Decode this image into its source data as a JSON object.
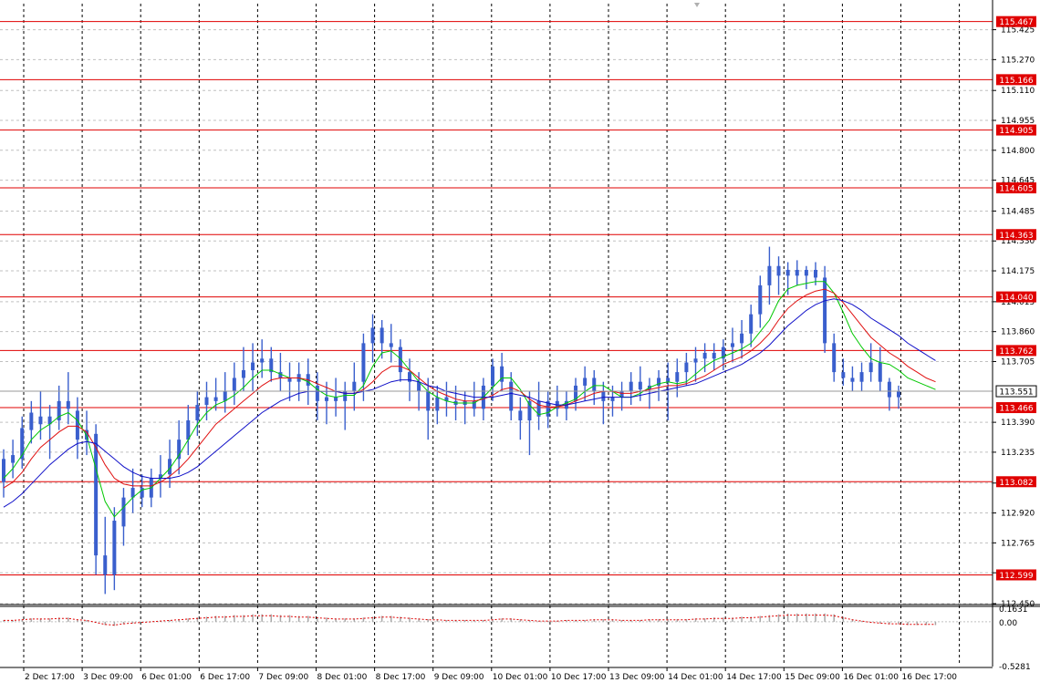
{
  "chart_data": {
    "type": "line",
    "symbol_scale": "price",
    "price_axis": {
      "ylim": [
        112.45,
        115.56
      ],
      "tick_labels": [
        "115.425",
        "115.270",
        "115.110",
        "114.955",
        "114.800",
        "114.645",
        "114.485",
        "114.330",
        "114.175",
        "114.015",
        "113.860",
        "113.705",
        "113.390",
        "113.235",
        "113.075",
        "112.920",
        "112.765",
        "112.610",
        "112.450"
      ],
      "current_price": "113.551"
    },
    "levels": [
      "115.467",
      "115.166",
      "114.905",
      "114.605",
      "114.363",
      "114.040",
      "113.762",
      "113.466",
      "113.082",
      "112.599"
    ],
    "time_axis": {
      "labels": [
        "2 Dec 17:00",
        "3 Dec 09:00",
        "6 Dec 01:00",
        "6 Dec 17:00",
        "7 Dec 09:00",
        "8 Dec 01:00",
        "8 Dec 17:00",
        "9 Dec 09:00",
        "10 Dec 01:00",
        "10 Dec 17:00",
        "13 Dec 09:00",
        "14 Dec 01:00",
        "14 Dec 17:00",
        "15 Dec 09:00",
        "16 Dec 01:00",
        "16 Dec 17:00"
      ]
    },
    "indicator": {
      "tick_labels": [
        "0.1631",
        "0.00",
        "-0.5281"
      ],
      "ylim": [
        -0.5281,
        0.1631
      ]
    },
    "series": [
      {
        "color": "#3a5fcd",
        "values": [
          113.15,
          113.2,
          113.28,
          113.35,
          113.42,
          113.4,
          113.45,
          113.5,
          113.38,
          113.3,
          113.25,
          112.75,
          112.62,
          112.85,
          113.0,
          113.05,
          113.0,
          113.08,
          113.12,
          113.18,
          113.25,
          113.35,
          113.45,
          113.52,
          113.5,
          113.55,
          113.6,
          113.62,
          113.7,
          113.72,
          113.68,
          113.65,
          113.6,
          113.65,
          113.62,
          113.55,
          113.52,
          113.5,
          113.55,
          113.52,
          113.6,
          113.75,
          113.85,
          113.82,
          113.7,
          113.65,
          113.6,
          113.55,
          113.5,
          113.52,
          113.48,
          113.5,
          113.45,
          113.55,
          113.6,
          113.7,
          113.62,
          113.5,
          113.42,
          113.38,
          113.45,
          113.5,
          113.48,
          113.52,
          113.58,
          113.62,
          113.6,
          113.55,
          113.48,
          113.5,
          113.55,
          113.58,
          113.62,
          113.6,
          113.58,
          113.6,
          113.65,
          113.7,
          113.72,
          113.75,
          113.72,
          113.78,
          113.82,
          113.9,
          113.95,
          114.1,
          114.15,
          114.1,
          114.12,
          114.15,
          114.12,
          114.1,
          113.85,
          113.7,
          113.65,
          113.62,
          113.6,
          113.7,
          113.65,
          113.58,
          113.55,
          113.55
        ]
      },
      {
        "color": "#00c800",
        "values": [
          113.1,
          113.15,
          113.22,
          113.3,
          113.35,
          113.38,
          113.42,
          113.44,
          113.4,
          113.32,
          113.15,
          112.98,
          112.9,
          112.95,
          113.0,
          113.04,
          113.05,
          113.1,
          113.15,
          113.22,
          113.3,
          113.38,
          113.44,
          113.48,
          113.5,
          113.53,
          113.57,
          113.62,
          113.66,
          113.66,
          113.64,
          113.62,
          113.62,
          113.6,
          113.56,
          113.53,
          113.52,
          113.53,
          113.53,
          113.58,
          113.68,
          113.75,
          113.76,
          113.72,
          113.66,
          113.6,
          113.55,
          113.52,
          113.5,
          113.49,
          113.49,
          113.49,
          113.52,
          113.57,
          113.62,
          113.62,
          113.56,
          113.48,
          113.43,
          113.44,
          113.47,
          113.49,
          113.51,
          113.55,
          113.58,
          113.58,
          113.55,
          113.52,
          113.52,
          113.54,
          113.57,
          113.59,
          113.6,
          113.59,
          113.6,
          113.64,
          113.68,
          113.71,
          113.73,
          113.75,
          113.77,
          113.8,
          113.86,
          113.92,
          114.02,
          114.08,
          114.1,
          114.11,
          114.12,
          114.12,
          114.06,
          113.96,
          113.85,
          113.78,
          113.72,
          113.7,
          113.69,
          113.66,
          113.62,
          113.6,
          113.58,
          113.56
        ]
      },
      {
        "color": "#e01010",
        "values": [
          113.05,
          113.08,
          113.13,
          113.2,
          113.26,
          113.3,
          113.34,
          113.37,
          113.37,
          113.34,
          113.26,
          113.17,
          113.1,
          113.07,
          113.06,
          113.06,
          113.06,
          113.08,
          113.11,
          113.15,
          113.2,
          113.26,
          113.32,
          113.38,
          113.42,
          113.46,
          113.5,
          113.54,
          113.58,
          113.61,
          113.62,
          113.62,
          113.62,
          113.61,
          113.59,
          113.57,
          113.55,
          113.54,
          113.54,
          113.56,
          113.6,
          113.65,
          113.68,
          113.68,
          113.66,
          113.62,
          113.58,
          113.55,
          113.53,
          113.51,
          113.5,
          113.5,
          113.51,
          113.53,
          113.56,
          113.57,
          113.55,
          113.51,
          113.48,
          113.47,
          113.47,
          113.48,
          113.5,
          113.52,
          113.54,
          113.55,
          113.55,
          113.54,
          113.54,
          113.55,
          113.56,
          113.57,
          113.58,
          113.58,
          113.59,
          113.61,
          113.63,
          113.66,
          113.69,
          113.71,
          113.73,
          113.76,
          113.8,
          113.85,
          113.92,
          113.98,
          114.02,
          114.05,
          114.07,
          114.08,
          114.06,
          114.01,
          113.95,
          113.89,
          113.83,
          113.79,
          113.75,
          113.72,
          113.68,
          113.65,
          113.62,
          113.6
        ]
      },
      {
        "color": "#1010c8",
        "values": [
          112.95,
          112.98,
          113.02,
          113.07,
          113.12,
          113.17,
          113.21,
          113.25,
          113.28,
          113.29,
          113.28,
          113.24,
          113.2,
          113.16,
          113.13,
          113.11,
          113.1,
          113.1,
          113.1,
          113.11,
          113.13,
          113.16,
          113.2,
          113.24,
          113.28,
          113.32,
          113.36,
          113.4,
          113.44,
          113.47,
          113.5,
          113.52,
          113.54,
          113.55,
          113.55,
          113.55,
          113.55,
          113.54,
          113.54,
          113.55,
          113.56,
          113.58,
          113.6,
          113.61,
          113.61,
          113.6,
          113.58,
          113.57,
          113.55,
          113.54,
          113.53,
          113.52,
          113.52,
          113.52,
          113.53,
          113.54,
          113.53,
          113.52,
          113.5,
          113.49,
          113.48,
          113.48,
          113.49,
          113.5,
          113.51,
          113.52,
          113.52,
          113.52,
          113.52,
          113.53,
          113.54,
          113.55,
          113.56,
          113.57,
          113.58,
          113.59,
          113.61,
          113.63,
          113.65,
          113.67,
          113.69,
          113.72,
          113.75,
          113.79,
          113.84,
          113.89,
          113.93,
          113.97,
          114.0,
          114.02,
          114.03,
          114.02,
          114.0,
          113.97,
          113.93,
          113.9,
          113.87,
          113.84,
          113.8,
          113.77,
          113.74,
          113.71
        ]
      }
    ],
    "candles": [
      [
        113.08,
        113.25,
        113.0,
        113.2
      ],
      [
        113.18,
        113.3,
        113.1,
        113.22
      ],
      [
        113.2,
        113.42,
        113.15,
        113.36
      ],
      [
        113.35,
        113.5,
        113.28,
        113.44
      ],
      [
        113.42,
        113.55,
        113.3,
        113.38
      ],
      [
        113.38,
        113.48,
        113.2,
        113.42
      ],
      [
        113.4,
        113.58,
        113.35,
        113.5
      ],
      [
        113.5,
        113.65,
        113.38,
        113.46
      ],
      [
        113.45,
        113.52,
        113.2,
        113.3
      ],
      [
        113.3,
        113.45,
        113.22,
        113.35
      ],
      [
        113.33,
        113.38,
        112.6,
        112.7
      ],
      [
        112.7,
        112.9,
        112.5,
        112.6
      ],
      [
        112.6,
        112.95,
        112.52,
        112.88
      ],
      [
        112.85,
        113.05,
        112.75,
        113.0
      ],
      [
        113.0,
        113.15,
        112.92,
        113.05
      ],
      [
        113.05,
        113.12,
        112.95,
        113.0
      ],
      [
        113.0,
        113.15,
        112.95,
        113.1
      ],
      [
        113.1,
        113.22,
        113.0,
        113.12
      ],
      [
        113.12,
        113.3,
        113.05,
        113.2
      ],
      [
        113.2,
        113.4,
        113.12,
        113.3
      ],
      [
        113.3,
        113.48,
        113.22,
        113.4
      ],
      [
        113.4,
        113.55,
        113.32,
        113.48
      ],
      [
        113.48,
        113.6,
        113.4,
        113.52
      ],
      [
        113.52,
        113.62,
        113.45,
        113.5
      ],
      [
        113.5,
        113.65,
        113.44,
        113.55
      ],
      [
        113.55,
        113.7,
        113.48,
        113.62
      ],
      [
        113.62,
        113.78,
        113.55,
        113.66
      ],
      [
        113.66,
        113.8,
        113.55,
        113.7
      ],
      [
        113.7,
        113.82,
        113.62,
        113.72
      ],
      [
        113.72,
        113.78,
        113.6,
        113.65
      ],
      [
        113.65,
        113.75,
        113.55,
        113.62
      ],
      [
        113.62,
        113.7,
        113.5,
        113.6
      ],
      [
        113.6,
        113.7,
        113.5,
        113.64
      ],
      [
        113.64,
        113.72,
        113.48,
        113.58
      ],
      [
        113.58,
        113.65,
        113.4,
        113.5
      ],
      [
        113.5,
        113.6,
        113.38,
        113.52
      ],
      [
        113.52,
        113.62,
        113.42,
        113.5
      ],
      [
        113.5,
        113.6,
        113.35,
        113.55
      ],
      [
        113.55,
        113.7,
        113.45,
        113.6
      ],
      [
        113.6,
        113.85,
        113.5,
        113.8
      ],
      [
        113.8,
        113.95,
        113.7,
        113.88
      ],
      [
        113.88,
        113.92,
        113.72,
        113.8
      ],
      [
        113.8,
        113.9,
        113.7,
        113.78
      ],
      [
        113.78,
        113.82,
        113.6,
        113.65
      ],
      [
        113.65,
        113.72,
        113.5,
        113.6
      ],
      [
        113.6,
        113.65,
        113.45,
        113.55
      ],
      [
        113.55,
        113.62,
        113.3,
        113.45
      ],
      [
        113.45,
        113.58,
        113.38,
        113.52
      ],
      [
        113.52,
        113.6,
        113.42,
        113.5
      ],
      [
        113.5,
        113.58,
        113.4,
        113.48
      ],
      [
        113.48,
        113.55,
        113.38,
        113.5
      ],
      [
        113.5,
        113.6,
        113.42,
        113.46
      ],
      [
        113.46,
        113.62,
        113.4,
        113.58
      ],
      [
        113.58,
        113.72,
        113.5,
        113.68
      ],
      [
        113.68,
        113.75,
        113.55,
        113.6
      ],
      [
        113.6,
        113.65,
        113.4,
        113.45
      ],
      [
        113.45,
        113.52,
        113.3,
        113.4
      ],
      [
        113.4,
        113.55,
        113.22,
        113.5
      ],
      [
        113.5,
        113.6,
        113.35,
        113.42
      ],
      [
        113.42,
        113.55,
        113.36,
        113.5
      ],
      [
        113.5,
        113.58,
        113.42,
        113.46
      ],
      [
        113.46,
        113.55,
        113.4,
        113.5
      ],
      [
        113.5,
        113.62,
        113.45,
        113.58
      ],
      [
        113.58,
        113.68,
        113.5,
        113.62
      ],
      [
        113.62,
        113.66,
        113.48,
        113.55
      ],
      [
        113.55,
        113.6,
        113.38,
        113.5
      ],
      [
        113.5,
        113.58,
        113.42,
        113.52
      ],
      [
        113.52,
        113.6,
        113.45,
        113.55
      ],
      [
        113.55,
        113.65,
        113.48,
        113.6
      ],
      [
        113.6,
        113.68,
        113.5,
        113.56
      ],
      [
        113.56,
        113.62,
        113.46,
        113.58
      ],
      [
        113.58,
        113.66,
        113.5,
        113.62
      ],
      [
        113.62,
        113.7,
        113.4,
        113.6
      ],
      [
        113.6,
        113.72,
        113.52,
        113.65
      ],
      [
        113.65,
        113.75,
        113.58,
        113.7
      ],
      [
        113.7,
        113.78,
        113.6,
        113.72
      ],
      [
        113.72,
        113.8,
        113.65,
        113.75
      ],
      [
        113.75,
        113.8,
        113.66,
        113.72
      ],
      [
        113.72,
        113.82,
        113.66,
        113.78
      ],
      [
        113.78,
        113.88,
        113.7,
        113.8
      ],
      [
        113.8,
        113.92,
        113.72,
        113.85
      ],
      [
        113.85,
        114.0,
        113.78,
        113.95
      ],
      [
        113.95,
        114.15,
        113.88,
        114.1
      ],
      [
        114.1,
        114.3,
        114.0,
        114.2
      ],
      [
        114.2,
        114.25,
        114.05,
        114.15
      ],
      [
        114.15,
        114.22,
        114.05,
        114.18
      ],
      [
        114.18,
        114.23,
        114.1,
        114.15
      ],
      [
        114.15,
        114.2,
        114.08,
        114.18
      ],
      [
        114.18,
        114.22,
        114.1,
        114.14
      ],
      [
        114.14,
        114.2,
        113.75,
        113.8
      ],
      [
        113.8,
        113.85,
        113.6,
        113.65
      ],
      [
        113.65,
        113.72,
        113.58,
        113.62
      ],
      [
        113.62,
        113.68,
        113.55,
        113.6
      ],
      [
        113.6,
        113.7,
        113.55,
        113.65
      ],
      [
        113.65,
        113.8,
        113.6,
        113.7
      ],
      [
        113.7,
        113.78,
        113.55,
        113.6
      ],
      [
        113.6,
        113.62,
        113.45,
        113.52
      ],
      [
        113.52,
        113.58,
        113.46,
        113.55
      ]
    ],
    "oscillator": [
      0.02,
      0.02,
      0.03,
      0.04,
      0.04,
      0.04,
      0.05,
      0.05,
      0.03,
      0.02,
      -0.01,
      -0.04,
      -0.05,
      -0.03,
      -0.02,
      -0.01,
      0.0,
      0.01,
      0.02,
      0.03,
      0.04,
      0.05,
      0.06,
      0.07,
      0.07,
      0.08,
      0.08,
      0.09,
      0.09,
      0.09,
      0.08,
      0.08,
      0.07,
      0.07,
      0.06,
      0.05,
      0.04,
      0.04,
      0.04,
      0.05,
      0.06,
      0.07,
      0.07,
      0.06,
      0.05,
      0.04,
      0.03,
      0.03,
      0.02,
      0.02,
      0.02,
      0.02,
      0.02,
      0.03,
      0.04,
      0.04,
      0.03,
      0.02,
      0.01,
      0.01,
      0.01,
      0.02,
      0.02,
      0.02,
      0.03,
      0.03,
      0.03,
      0.02,
      0.02,
      0.02,
      0.03,
      0.03,
      0.03,
      0.03,
      0.03,
      0.04,
      0.04,
      0.05,
      0.05,
      0.05,
      0.06,
      0.06,
      0.07,
      0.08,
      0.09,
      0.1,
      0.1,
      0.1,
      0.1,
      0.1,
      0.09,
      0.06,
      0.03,
      0.01,
      -0.01,
      -0.02,
      -0.03,
      -0.03,
      -0.04,
      -0.04,
      -0.04,
      -0.04
    ],
    "grid": true
  }
}
